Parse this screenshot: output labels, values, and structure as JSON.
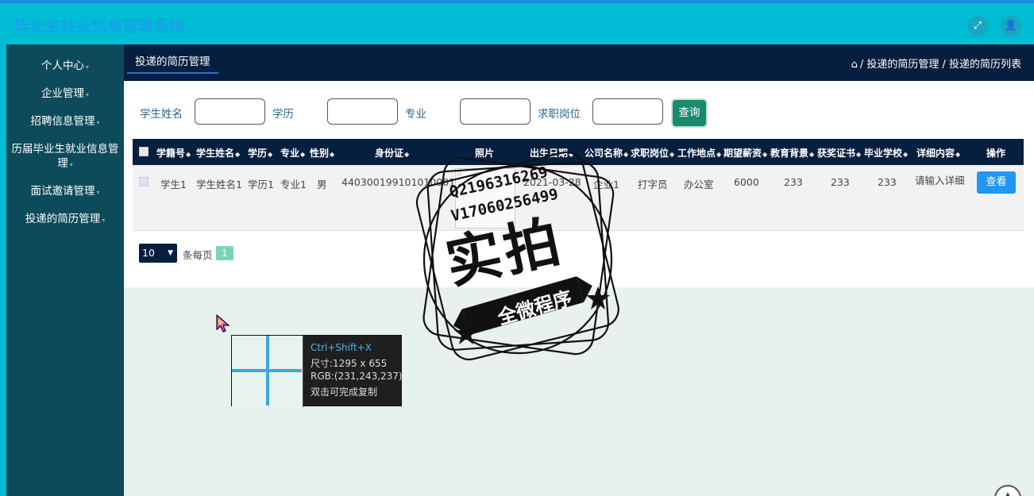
{
  "app": {
    "title": "毕业生就业信息管理系统",
    "icons": [
      "fullscreen-icon",
      "user-icon"
    ]
  },
  "sidebar": {
    "items": [
      {
        "label": "个人中心"
      },
      {
        "label": "企业管理"
      },
      {
        "label": "招聘信息管理"
      },
      {
        "label": "历届毕业生就业信息管理"
      },
      {
        "label": "面试邀请管理"
      },
      {
        "label": "投递的简历管理"
      }
    ]
  },
  "tabbar": {
    "tab": "投递的简历管理",
    "breadcrumb": "/ 投递的简历管理 / 投递的简历列表"
  },
  "search": {
    "fields": [
      {
        "label": "学生姓名",
        "value": ""
      },
      {
        "label": "学历",
        "value": ""
      },
      {
        "label": "专业",
        "value": ""
      },
      {
        "label": "求职岗位",
        "value": ""
      }
    ],
    "button": "查询"
  },
  "table": {
    "columns": [
      "学籍号",
      "学生姓名",
      "学历",
      "专业",
      "性别",
      "身份证",
      "照片",
      "出生日期",
      "公司名称",
      "求职岗位",
      "工作地点",
      "期望薪资",
      "教育背景",
      "获奖证书",
      "毕业学校",
      "详细内容",
      "操作"
    ],
    "rows": [
      {
        "student_no": "学生1",
        "student_name": "学生姓名1",
        "education": "学历1",
        "major": "专业1",
        "gender": "男",
        "id_card": "440300199101010001",
        "birth_date": "2021-03-28",
        "company": "企业1",
        "position": "打字员",
        "location": "办公室",
        "salary": "6000",
        "edu_background": "233",
        "awards": "233",
        "school": "233",
        "details": "请输入详细",
        "action": "查看"
      }
    ]
  },
  "pagination": {
    "page_size": "10",
    "page_size_label": "条每页",
    "current_page": "1"
  },
  "watermark": {
    "line1": "Q2196316269",
    "line2": "V17060256499",
    "big": "实拍",
    "banner": "全微程序"
  },
  "capture_tooltip": {
    "shortcut": "Ctrl+Shift+X",
    "size": "尺寸:1295 x 655",
    "rgb": "RGB:(231,243,237)",
    "hint": "双击可完成复制"
  }
}
